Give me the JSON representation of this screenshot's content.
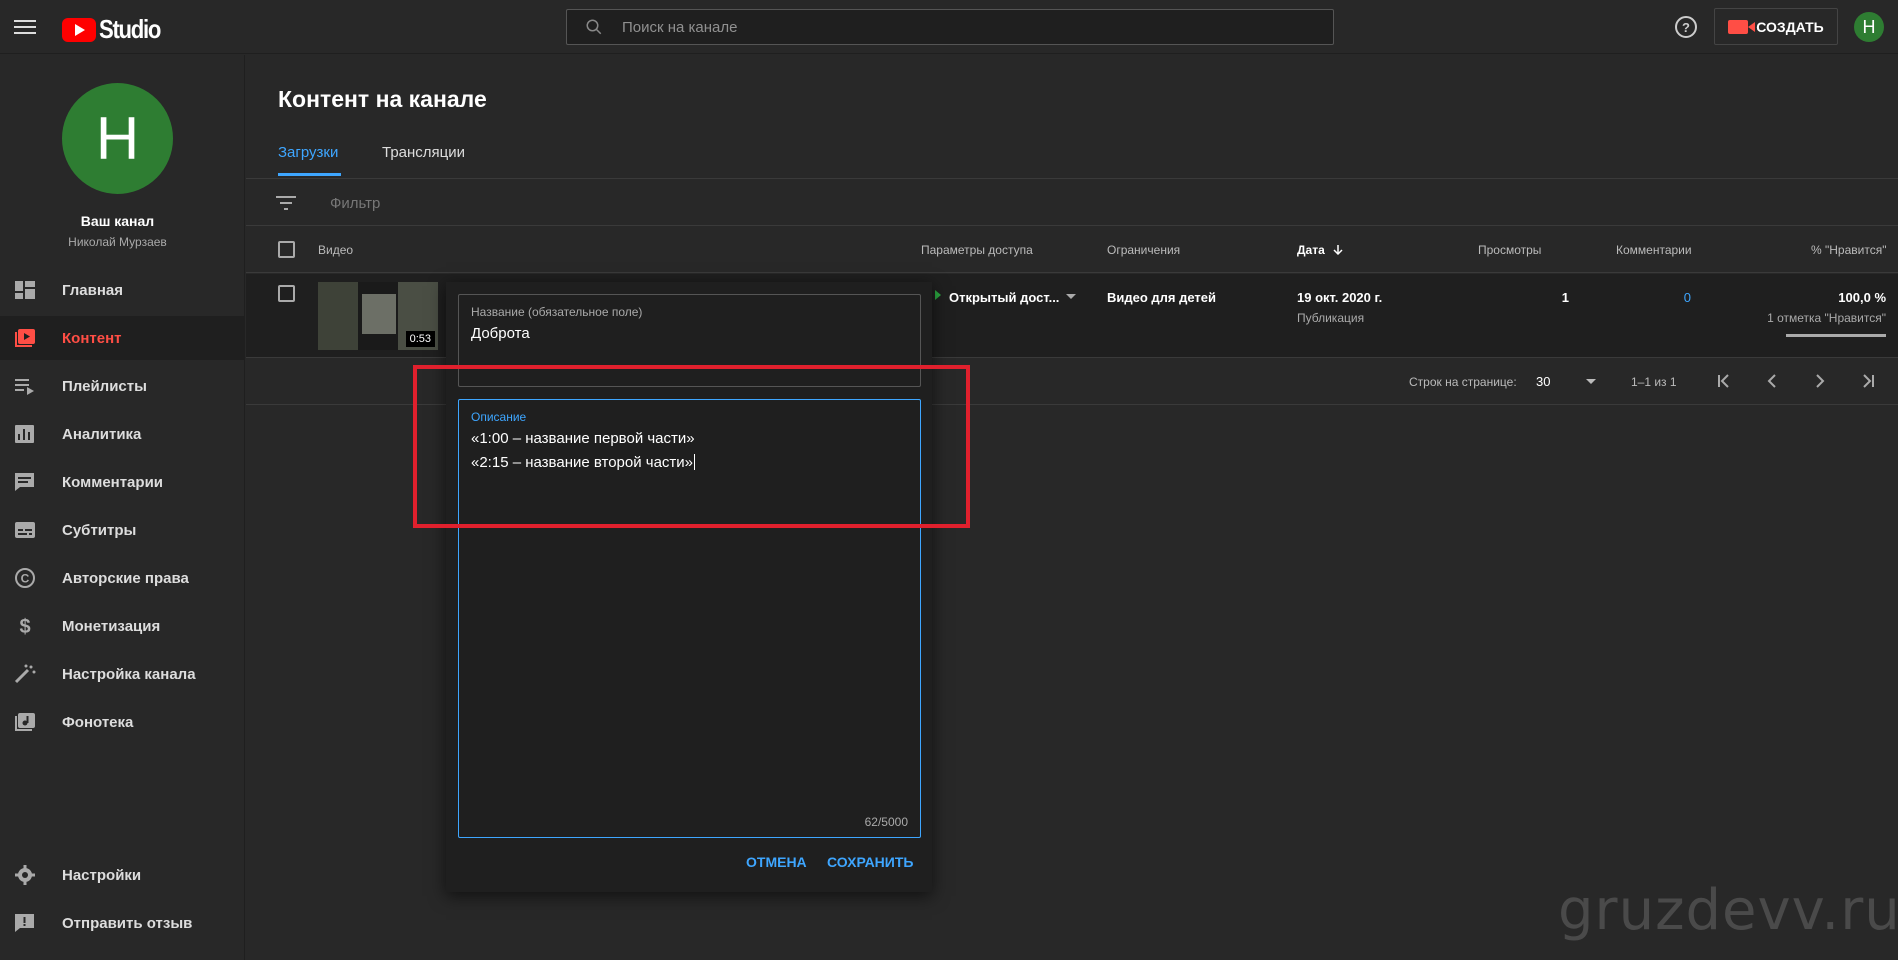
{
  "header": {
    "logo_text": "Studio",
    "search_placeholder": "Поиск на канале",
    "create_label": "СОЗДАТЬ",
    "avatar_letter": "Н"
  },
  "sidebar": {
    "avatar_letter": "Н",
    "channel_title": "Ваш канал",
    "channel_name": "Николай Мурзаев",
    "items": [
      {
        "label": "Главная",
        "icon": "dashboard-icon"
      },
      {
        "label": "Контент",
        "icon": "content-icon",
        "active": true
      },
      {
        "label": "Плейлисты",
        "icon": "playlist-icon"
      },
      {
        "label": "Аналитика",
        "icon": "analytics-icon"
      },
      {
        "label": "Комментарии",
        "icon": "comments-icon"
      },
      {
        "label": "Субтитры",
        "icon": "subtitles-icon"
      },
      {
        "label": "Авторские права",
        "icon": "copyright-icon"
      },
      {
        "label": "Монетизация",
        "icon": "dollar-icon"
      },
      {
        "label": "Настройка канала",
        "icon": "magic-wand-icon"
      },
      {
        "label": "Фонотека",
        "icon": "audio-library-icon"
      }
    ],
    "bottom_items": [
      {
        "label": "Настройки",
        "icon": "gear-icon"
      },
      {
        "label": "Отправить отзыв",
        "icon": "feedback-icon"
      }
    ]
  },
  "main": {
    "title": "Контент на канале",
    "tabs": [
      {
        "label": "Загрузки",
        "active": true
      },
      {
        "label": "Трансляции",
        "active": false
      }
    ],
    "filter_placeholder": "Фильтр",
    "columns": {
      "video": "Видео",
      "visibility": "Параметры доступа",
      "restrictions": "Ограничения",
      "date": "Дата",
      "views": "Просмотры",
      "comments": "Комментарии",
      "likes": "% \"Нравится\""
    },
    "rows": [
      {
        "duration": "0:53",
        "visibility": "Открытый дост...",
        "restrictions": "Видео для детей",
        "date": "19 окт. 2020 г.",
        "date_sub": "Публикация",
        "views": "1",
        "comments": "0",
        "likes": "100,0 %",
        "likes_sub": "1 отметка \"Нравится\"",
        "likes_fraction": 1.0
      }
    ],
    "pager": {
      "rows_label": "Строк на странице:",
      "rows_value": "30",
      "range": "1–1 из 1"
    }
  },
  "editor": {
    "title_label": "Название (обязательное поле)",
    "title_value": "Доброта",
    "desc_label": "Описание",
    "desc_line1": "«1:00 – название первой части»",
    "desc_line2": "«2:15 – название второй части»",
    "counter": "62/5000",
    "cancel_label": "ОТМЕНА",
    "save_label": "СОХРАНИТЬ"
  },
  "watermark": "gruzdevv.ru",
  "colors": {
    "accent": "#3ea6ff",
    "active_nav": "#ff4e45",
    "highlight": "#e0202d",
    "avatar": "#2e7d32"
  }
}
